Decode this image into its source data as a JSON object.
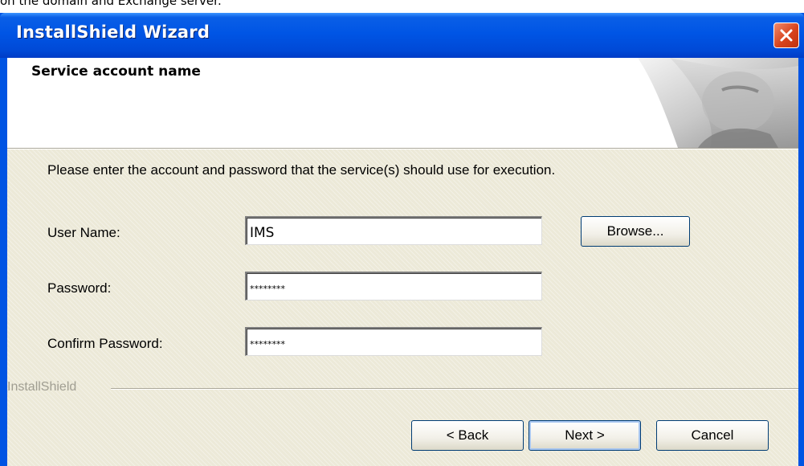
{
  "caption": "on the domain and Exchange server.",
  "window": {
    "title": "InstallShield Wizard"
  },
  "header": {
    "title": "Service account name"
  },
  "body": {
    "intro": "Please enter the account and password that the service(s) should use for execution.",
    "fields": {
      "user_name": {
        "label": "User Name:",
        "value": "IMS"
      },
      "password": {
        "label": "Password:",
        "value": "********"
      },
      "confirm_password": {
        "label": "Confirm Password:",
        "value": "********"
      }
    },
    "browse_label": "Browse...",
    "group_label": "InstallShield"
  },
  "buttons": {
    "back": "< Back",
    "next": "Next >",
    "cancel": "Cancel"
  },
  "icons": [
    "close-icon",
    "header-graphic"
  ],
  "colors": {
    "titlebar": "#0054e3",
    "close_button": "#d8431c",
    "dialog_bg": "#ece9d8",
    "header_bg": "#ffffff"
  }
}
